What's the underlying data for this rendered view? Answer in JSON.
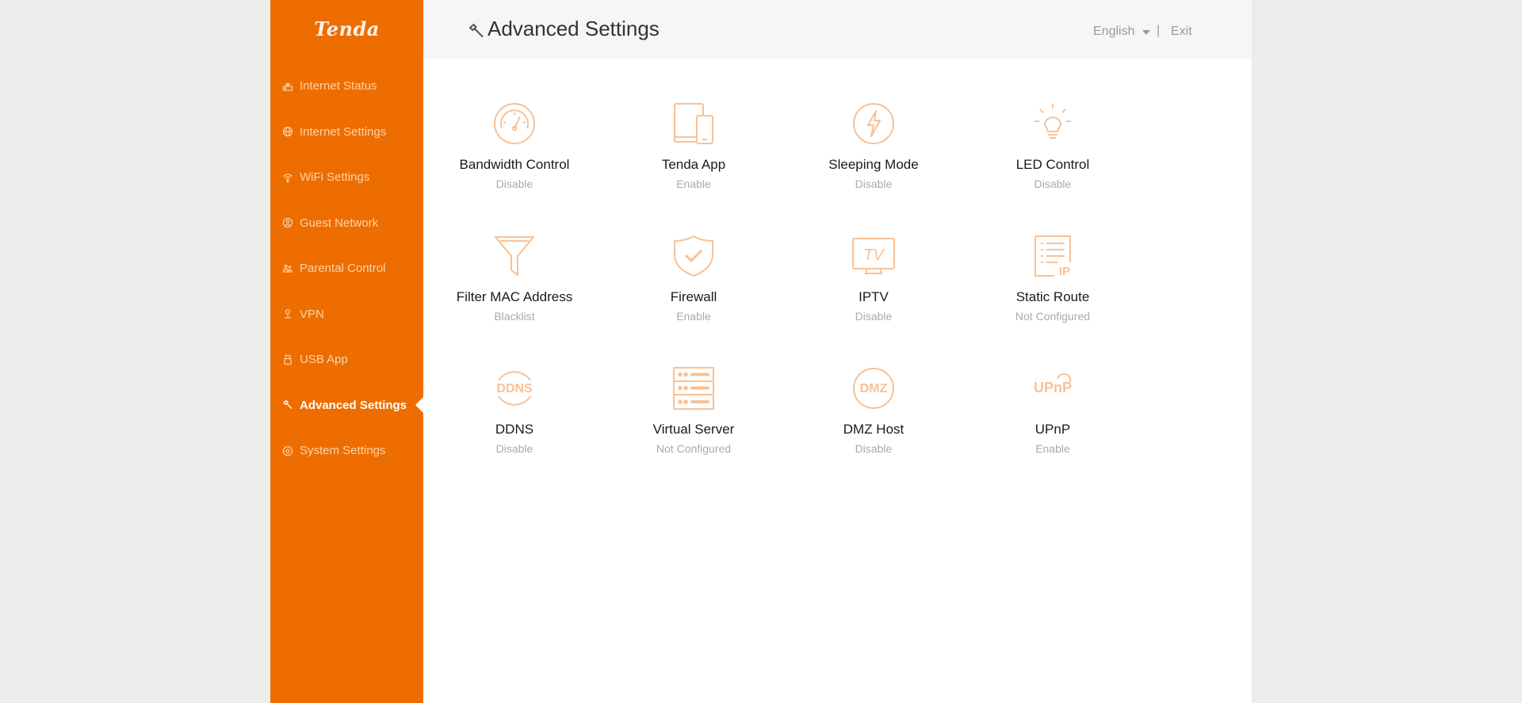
{
  "brand": {
    "logo_text": "Tenda",
    "accent": "#ee6d00",
    "icon_color": "#f8c195"
  },
  "sidebar": {
    "items": [
      {
        "label": "Internet Status",
        "icon": "router-icon"
      },
      {
        "label": "Internet Settings",
        "icon": "globe-icon"
      },
      {
        "label": "WiFi Settings",
        "icon": "wifi-icon"
      },
      {
        "label": "Guest Network",
        "icon": "guest-network-icon"
      },
      {
        "label": "Parental Control",
        "icon": "parental-control-icon"
      },
      {
        "label": "VPN",
        "icon": "vpn-icon"
      },
      {
        "label": "USB App",
        "icon": "usb-icon"
      },
      {
        "label": "Advanced Settings",
        "icon": "wrench-icon",
        "active": true
      },
      {
        "label": "System Settings",
        "icon": "gear-icon"
      }
    ]
  },
  "header": {
    "title": "Advanced Settings",
    "language": "English",
    "separator": "|",
    "exit_label": "Exit"
  },
  "tiles": [
    {
      "label": "Bandwidth Control",
      "status": "Disable",
      "icon": "speedometer-icon"
    },
    {
      "label": "Tenda App",
      "status": "Enable",
      "icon": "devices-icon"
    },
    {
      "label": "Sleeping Mode",
      "status": "Disable",
      "icon": "lightning-icon"
    },
    {
      "label": "LED Control",
      "status": "Disable",
      "icon": "light-bulb-icon"
    },
    {
      "label": "Filter MAC Address",
      "status": "Blacklist",
      "icon": "funnel-icon"
    },
    {
      "label": "Firewall",
      "status": "Enable",
      "icon": "shield-check-icon"
    },
    {
      "label": "IPTV",
      "status": "Disable",
      "icon": "tv-icon",
      "icon_text": "TV"
    },
    {
      "label": "Static Route",
      "status": "Not Configured",
      "icon": "static-route-icon",
      "icon_text": "IP"
    },
    {
      "label": "DDNS",
      "status": "Disable",
      "icon": "ddns-icon",
      "icon_text": "DDNS"
    },
    {
      "label": "Virtual Server",
      "status": "Not Configured",
      "icon": "server-icon"
    },
    {
      "label": "DMZ Host",
      "status": "Disable",
      "icon": "dmz-icon",
      "icon_text": "DMZ"
    },
    {
      "label": "UPnP",
      "status": "Enable",
      "icon": "upnp-icon",
      "icon_text": "UPnP"
    }
  ]
}
